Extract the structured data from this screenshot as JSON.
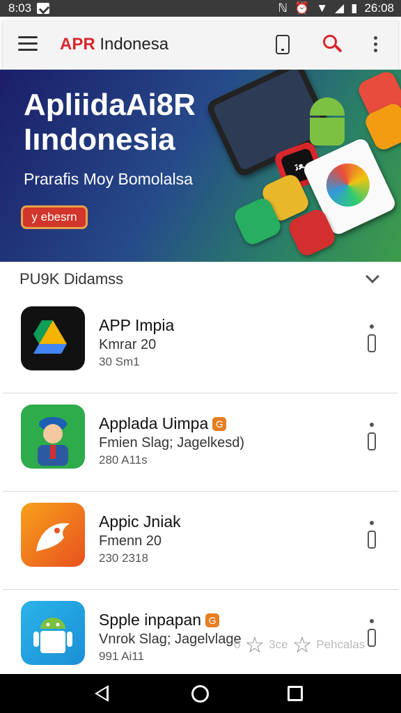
{
  "status_bar": {
    "time_left": "8:03",
    "time_right": "26:08",
    "icons": [
      "notification-check-icon",
      "nfc-icon",
      "alarm-icon",
      "wifi-icon",
      "signal-icon",
      "battery-icon"
    ]
  },
  "app_bar": {
    "brand_prefix": "APR",
    "brand_name": "Indonesa",
    "icons": [
      "menu-icon",
      "device-icon",
      "search-icon",
      "more-icon"
    ]
  },
  "banner": {
    "title_line1": "ApliidaAi8R",
    "title_line2": "Iındonesia",
    "subtitle": "Prarafis Moy Bomolalsa",
    "button_label": "y ebesrn",
    "watch_text": "ﻌﺗ"
  },
  "section": {
    "title": "PU9K Didamss"
  },
  "apps": [
    {
      "name": "APP Impia",
      "badge": "",
      "sub": "Kmrar 20",
      "meta": "30 Sm1",
      "icon": "drive-icon"
    },
    {
      "name": "Applada Uimpa",
      "badge": "G",
      "sub": "Fmien Slag; Jagelkesd)",
      "meta": "280 A11s",
      "icon": "person-icon"
    },
    {
      "name": "Appic Jniak",
      "badge": "",
      "sub": "Fmenn 20",
      "meta": "230 2318",
      "icon": "bird-icon"
    },
    {
      "name": "Spple inpapan",
      "badge": "G",
      "sub": "Vnrok Slag; Jagelvlage",
      "meta": "991 Ai11",
      "icon": "android-icon"
    }
  ],
  "rating_row": {
    "left_text": "0",
    "mid_text": "3ce",
    "right_text": "Pehcalas"
  },
  "colors": {
    "accent": "#d8262c",
    "badge": "#e67e22",
    "navbar": "#000000"
  }
}
